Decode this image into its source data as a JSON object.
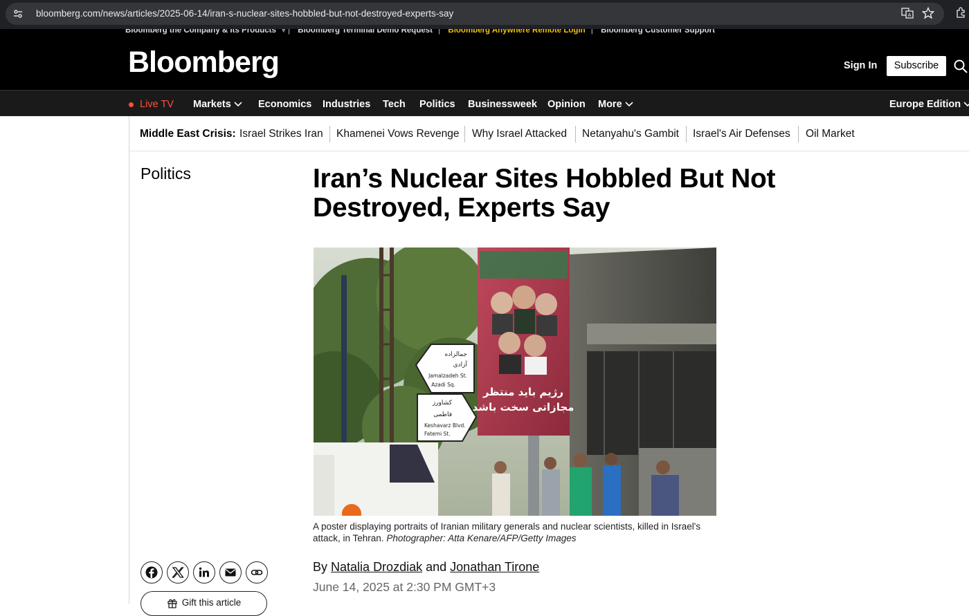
{
  "browser": {
    "url": "bloomberg.com/news/articles/2025-06-14/iran-s-nuclear-sites-hobbled-but-not-destroyed-experts-say"
  },
  "header": {
    "top_links": [
      "Bloomberg the Company & Its Products",
      "Bloomberg Terminal Demo Request",
      "Bloomberg Anywhere Remote Login",
      "Bloomberg Customer Support"
    ],
    "logo": "Bloomberg",
    "sign_in": "Sign In",
    "subscribe": "Subscribe"
  },
  "nav": {
    "live_tv": "Live TV",
    "markets": "Markets",
    "economics": "Economics",
    "industries": "Industries",
    "tech": "Tech",
    "politics": "Politics",
    "businessweek": "Businessweek",
    "opinion": "Opinion",
    "more": "More",
    "edition": "Europe Edition"
  },
  "topic_strip": {
    "label": "Middle East Crisis:",
    "links": [
      "Israel Strikes Iran",
      "Khamenei Vows Revenge",
      "Why Israel Attacked",
      "Netanyahu's Gambit",
      "Israel's Air Defenses",
      "Oil Market"
    ]
  },
  "article": {
    "section": "Politics",
    "headline": "Iran’s Nuclear Sites Hobbled But Not Destroyed, Experts Say",
    "caption": "A poster displaying portraits of Iranian military generals and nuclear scientists, killed in Israel's attack, in Tehran.",
    "credit": "Photographer: Atta Kenare/AFP/Getty Images",
    "byline_prefix": "By",
    "author1": "Natalia Drozdiak",
    "byline_and": "and",
    "author2": "Jonathan Tirone",
    "date": "June 14, 2025 at 2:30 PM GMT+3",
    "gift": "Gift this article"
  },
  "photo_text": {
    "sign1": [
      "جمالزاده",
      "آزادی",
      "Jamalzadeh St.",
      "Azadi Sq."
    ],
    "sign2": [
      "کشاورز",
      "فاطمی",
      "Keshavarz Blvd.",
      "Fatemi St."
    ],
    "poster": [
      "رژیم باید منتظر",
      "مجازاتی سخت باشد"
    ]
  },
  "colors": {
    "live": "#ff4f3d",
    "header_bg": "#000000",
    "nav_bg": "#1a1a1a"
  }
}
